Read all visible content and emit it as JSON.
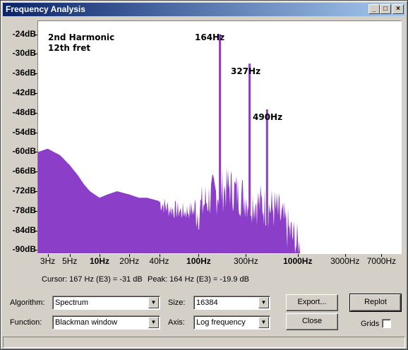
{
  "window": {
    "title": "Frequency Analysis",
    "minimize_glyph": "_",
    "maximize_glyph": "□",
    "close_glyph": "×"
  },
  "plot": {
    "annotation_title": "2nd Harmonic",
    "annotation_subtitle": "12th fret",
    "peak_labels": [
      "164Hz",
      "327Hz",
      "490Hz"
    ],
    "fill_color": "#8b3ec8",
    "background_color": "#ffffff"
  },
  "chart_data": {
    "type": "area",
    "title": "",
    "xlabel": "",
    "ylabel": "",
    "x_scale": "log",
    "ylim": [
      -91,
      -20
    ],
    "y_ticks": [
      "-24dB",
      "-30dB",
      "-36dB",
      "-42dB",
      "-48dB",
      "-54dB",
      "-60dB",
      "-66dB",
      "-72dB",
      "-78dB",
      "-84dB",
      "-90dB"
    ],
    "x_ticks": [
      "3Hz",
      "5Hz",
      "10Hz",
      "20Hz",
      "40Hz",
      "100Hz",
      "300Hz",
      "1000Hz",
      "3000Hz",
      "7000Hz"
    ],
    "x_ticks_major": [
      "10Hz",
      "100Hz",
      "1000Hz"
    ],
    "peaks": [
      {
        "label": "164Hz",
        "x": 164,
        "y": -24
      },
      {
        "label": "327Hz",
        "x": 327,
        "y": -33
      },
      {
        "label": "490Hz",
        "x": 490,
        "y": -47
      }
    ],
    "envelope": {
      "x": [
        2.4,
        3,
        4,
        5,
        6,
        7,
        8,
        10,
        12,
        15,
        20,
        25,
        30,
        40,
        50,
        70,
        100,
        130,
        164,
        200,
        250,
        327,
        400,
        490,
        600,
        800,
        1000,
        1100
      ],
      "y": [
        -60,
        -59,
        -61,
        -64,
        -67,
        -70,
        -72,
        -74,
        -73,
        -72,
        -73,
        -74,
        -74,
        -75,
        -77,
        -78,
        -77,
        -73,
        -24,
        -70,
        -72,
        -33,
        -75,
        -47,
        -77,
        -83,
        -88,
        -91
      ]
    },
    "grid": false,
    "legend": "none"
  },
  "status": {
    "cursor_text": "Cursor: 167 Hz (E3) = -31 dB",
    "peak_text": "Peak: 164 Hz (E3) = -19.9 dB"
  },
  "controls": {
    "algorithm_label": "Algorithm:",
    "algorithm_value": "Spectrum",
    "function_label": "Function:",
    "function_value": "Blackman window",
    "size_label": "Size:",
    "size_value": "16384",
    "axis_label": "Axis:",
    "axis_value": "Log frequency",
    "export_label": "Export...",
    "close_label": "Close",
    "replot_label": "Replot",
    "grids_label": "Grids",
    "grids_checked": false,
    "dropdown_glyph": "▼"
  }
}
